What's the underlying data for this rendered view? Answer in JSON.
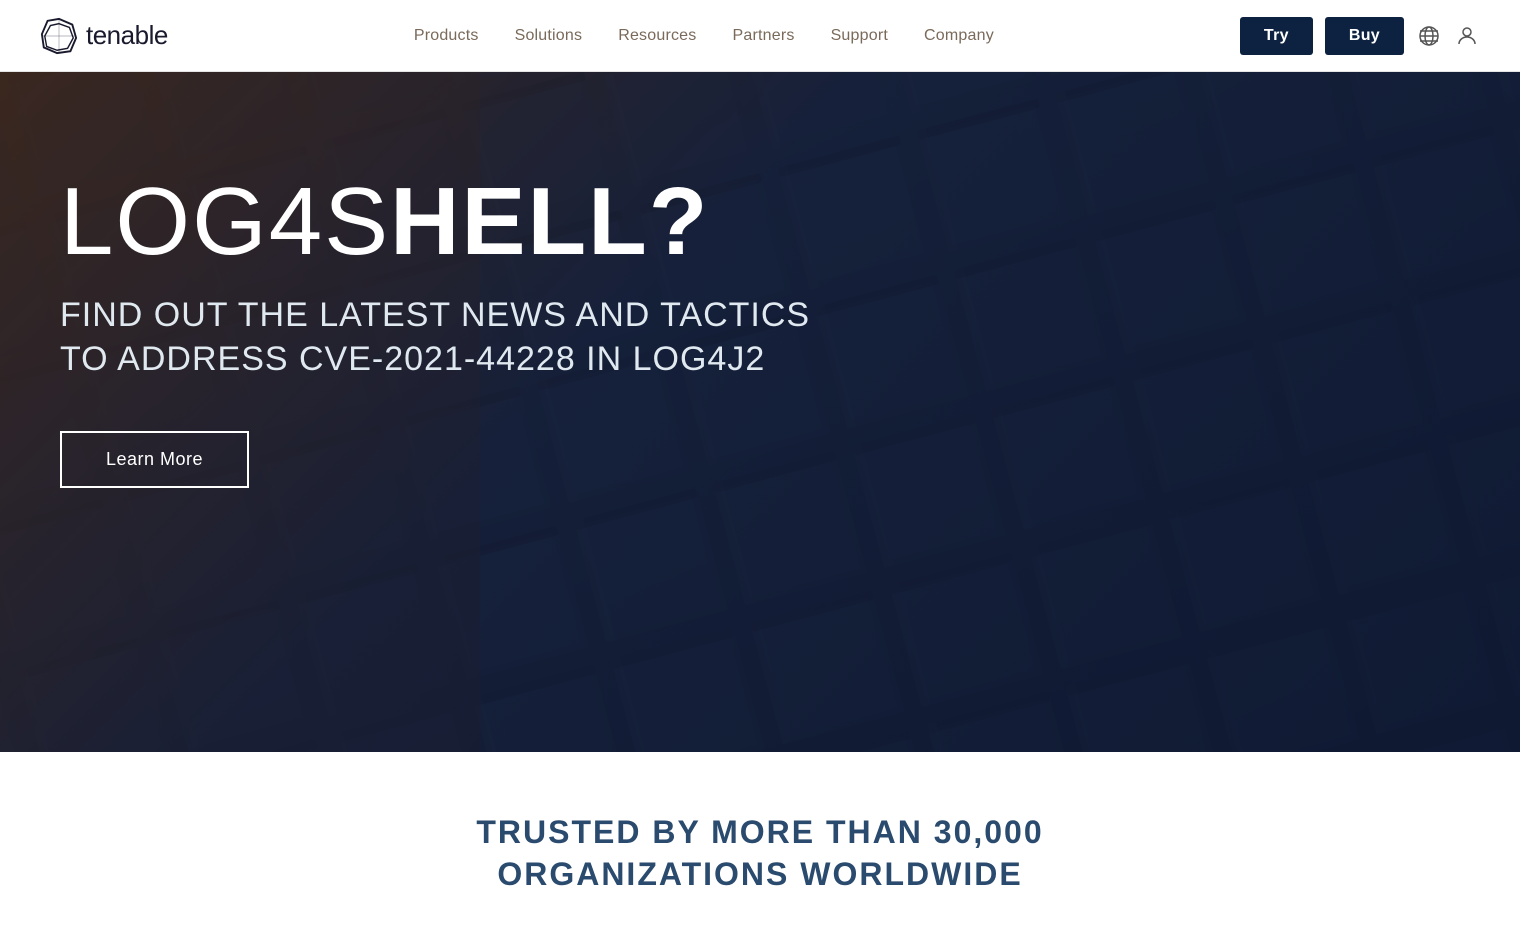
{
  "navbar": {
    "logo_text": "tenable",
    "nav_items": [
      {
        "label": "Products",
        "id": "products"
      },
      {
        "label": "Solutions",
        "id": "solutions"
      },
      {
        "label": "Resources",
        "id": "resources"
      },
      {
        "label": "Partners",
        "id": "partners"
      },
      {
        "label": "Support",
        "id": "support"
      },
      {
        "label": "Company",
        "id": "company"
      }
    ],
    "btn_try": "Try",
    "btn_buy": "Buy"
  },
  "hero": {
    "title_thin": "LOG4S",
    "title_bold": "HELL?",
    "subtitle": "FIND OUT THE LATEST NEWS AND TACTICS TO ADDRESS CVE-2021-44228 IN LOG4J2",
    "cta_label": "Learn More"
  },
  "trusted": {
    "line1": "TRUSTED BY MORE THAN 30,000",
    "line2": "ORGANIZATIONS WORLDWIDE"
  }
}
